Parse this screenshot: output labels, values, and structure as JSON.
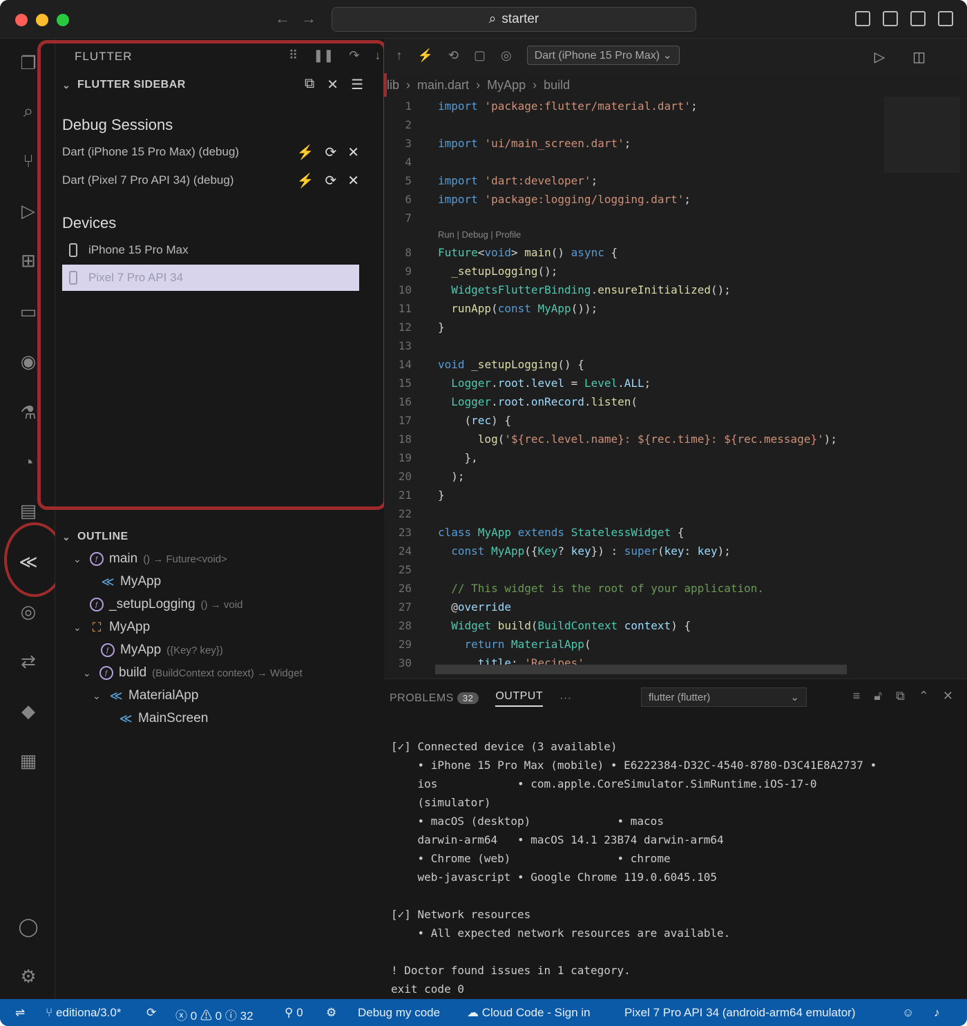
{
  "titlebar": {
    "search_text": "starter"
  },
  "sidebar": {
    "header": "FLUTTER",
    "flutter_section": "FLUTTER SIDEBAR",
    "debug_sessions_title": "Debug Sessions",
    "sessions": [
      {
        "label": "Dart (iPhone 15 Pro Max) (debug)"
      },
      {
        "label": "Dart (Pixel 7 Pro API 34) (debug)"
      }
    ],
    "devices_title": "Devices",
    "devices": [
      {
        "label": "iPhone 15 Pro Max"
      },
      {
        "label": "Pixel 7 Pro API 34"
      }
    ],
    "outline_title": "OUTLINE",
    "outline": [
      {
        "label": "main",
        "detail": "() → Future<void>"
      },
      {
        "label": "MyApp",
        "detail": ""
      },
      {
        "label": "_setupLogging",
        "detail": "() → void"
      },
      {
        "label": "MyApp",
        "detail": ""
      },
      {
        "label": "MyApp",
        "detail": "({Key? key})"
      },
      {
        "label": "build",
        "detail": "(BuildContext context) → Widget"
      },
      {
        "label": "MaterialApp",
        "detail": ""
      },
      {
        "label": "MainScreen",
        "detail": ""
      }
    ]
  },
  "editor": {
    "debug_config": "Dart (iPhone 15 Pro Max)",
    "breadcrumb": [
      "lib",
      "main.dart",
      "MyApp",
      "build"
    ],
    "codelens": "Run | Debug | Profile",
    "line_numbers": [
      "1",
      "2",
      "3",
      "4",
      "5",
      "6",
      "7",
      "8",
      "9",
      "10",
      "11",
      "12",
      "13",
      "14",
      "15",
      "16",
      "17",
      "18",
      "19",
      "20",
      "21",
      "22",
      "23",
      "24",
      "25",
      "26",
      "27",
      "28",
      "29",
      "30"
    ]
  },
  "panel": {
    "tab_problems": "PROBLEMS",
    "problems_count": "32",
    "tab_output": "OUTPUT",
    "more": "···",
    "channel": "flutter (flutter)",
    "output_lines": [
      "[✓] Connected device (3 available)",
      "    • iPhone 15 Pro Max (mobile) • E6222384-D32C-4540-8780-D3C41E8A2737 •",
      "    ios            • com.apple.CoreSimulator.SimRuntime.iOS-17-0",
      "    (simulator)",
      "    • macOS (desktop)             • macos",
      "    darwin-arm64   • macOS 14.1 23B74 darwin-arm64",
      "    • Chrome (web)                • chrome",
      "    web-javascript • Google Chrome 119.0.6045.105",
      "",
      "[✓] Network resources",
      "    • All expected network resources are available.",
      "",
      "! Doctor found issues in 1 category.",
      "exit code 0"
    ]
  },
  "statusbar": {
    "branch": "editiona/3.0*",
    "errors": "0",
    "warnings": "0",
    "info": "32",
    "ports": "0",
    "debug": "Debug my code",
    "cloud": "Cloud Code - Sign in",
    "device": "Pixel 7 Pro API 34 (android-arm64 emulator)"
  },
  "colors": {
    "highlight_red": "#9d2b2b",
    "statusbar_blue": "#0a5aa8",
    "selected_device": "#d7d4ec"
  }
}
